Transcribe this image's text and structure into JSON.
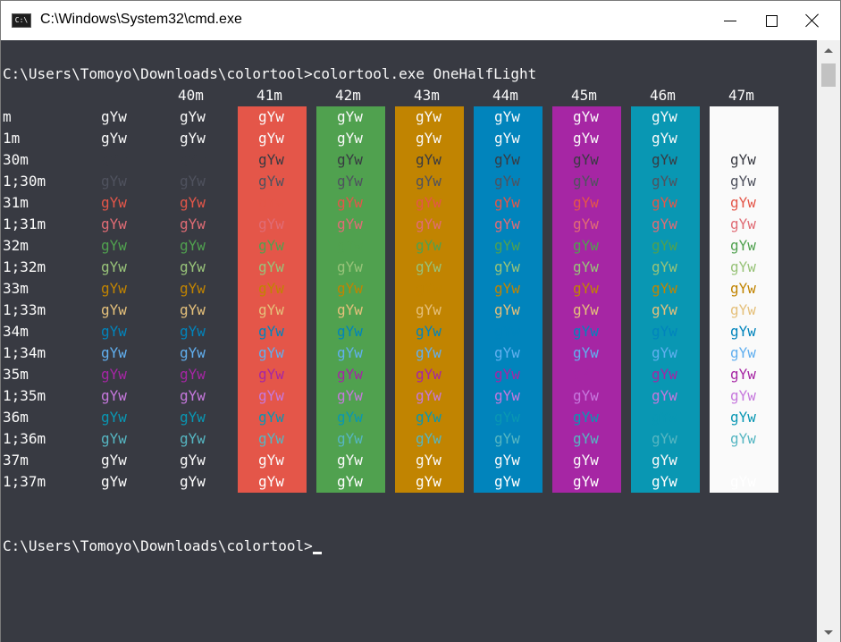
{
  "window": {
    "title": "C:\\Windows\\System32\\cmd.exe",
    "icon_text": "C:\\"
  },
  "colors": {
    "terminal_bg": "#383a42",
    "fg": {
      "m": "#fafafa",
      "1m": "#fafafa",
      "30m": "#383a42",
      "1;30m": "#4f525e",
      "31m": "#e45649",
      "1;31m": "#e06c75",
      "32m": "#50a14f",
      "1;32m": "#98c379",
      "33m": "#c18401",
      "1;33m": "#e5c07b",
      "34m": "#0184bc",
      "1;34m": "#61afef",
      "35m": "#a626a4",
      "1;35m": "#c678dd",
      "36m": "#0997b3",
      "1;36m": "#56b6c2",
      "37m": "#fafafa",
      "1;37m": "#ffffff"
    },
    "bg": {
      "41m": "#e45649",
      "42m": "#50a14f",
      "43m": "#c18401",
      "44m": "#0184bc",
      "45m": "#a626a4",
      "46m": "#0997b3",
      "47m": "#fafafa"
    }
  },
  "console": {
    "command_line": "C:\\Users\\Tomoyo\\Downloads\\colortool>colortool.exe OneHalfLight",
    "prompt_line": "C:\\Users\\Tomoyo\\Downloads\\colortool>",
    "sample_text": "gYw",
    "column_headers": [
      "40m",
      "41m",
      "42m",
      "43m",
      "44m",
      "45m",
      "46m",
      "47m"
    ],
    "row_labels": [
      "m",
      "1m",
      "30m",
      "1;30m",
      "31m",
      "1;31m",
      "32m",
      "1;32m",
      "33m",
      "1;33m",
      "34m",
      "1;34m",
      "35m",
      "1;35m",
      "36m",
      "1;36m",
      "37m",
      "1;37m"
    ]
  }
}
